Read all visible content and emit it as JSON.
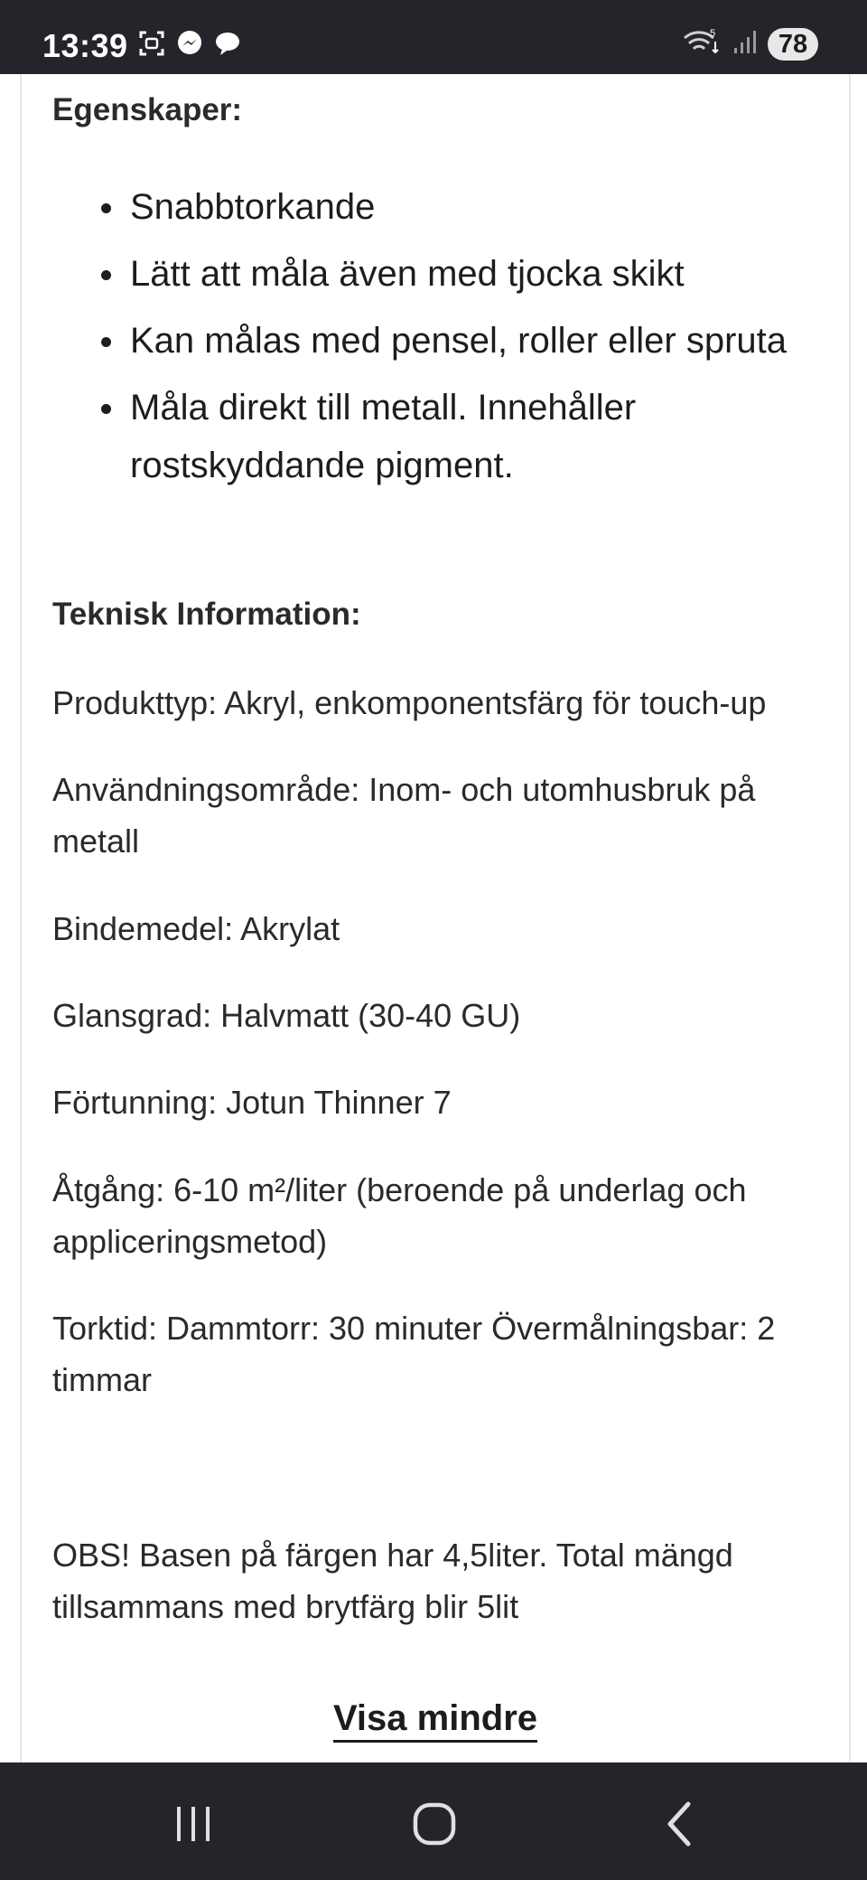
{
  "status_bar": {
    "time": "13:39",
    "left_icons": [
      "screenshot-icon",
      "messenger-icon",
      "chat-bubble-icon"
    ],
    "right_icons": [
      "wifi-5g-icon",
      "signal-icon"
    ],
    "battery": "78"
  },
  "egenskaper": {
    "heading": "Egenskaper:",
    "items": [
      "Snabbtorkande",
      "Lätt att måla även med tjocka skikt",
      "Kan målas med pensel, roller eller spruta",
      "Måla direkt till metall. Innehåller rostskyddande pigment."
    ]
  },
  "teknisk": {
    "heading": "Teknisk Information:",
    "lines": [
      "Produkttyp: Akryl, enkomponentsfärg för touch-up",
      "Användningsområde: Inom- och utomhusbruk på metall",
      "Bindemedel: Akrylat",
      "Glansgrad: Halvmatt (30-40 GU)",
      "Förtunning: Jotun Thinner 7",
      "Åtgång: 6-10 m²/liter (beroende på underlag och appliceringsmetod)",
      "Torktid: Dammtorr: 30 minuter Övermålningsbar: 2 timmar"
    ]
  },
  "obs_note": "OBS! Basen på färgen har 4,5liter. Total mängd tillsammans med brytfärg blir 5lit",
  "show_less_label": "Visa mindre",
  "nav_bar": {
    "buttons": [
      "recent-apps-icon",
      "home-icon",
      "back-icon"
    ]
  }
}
